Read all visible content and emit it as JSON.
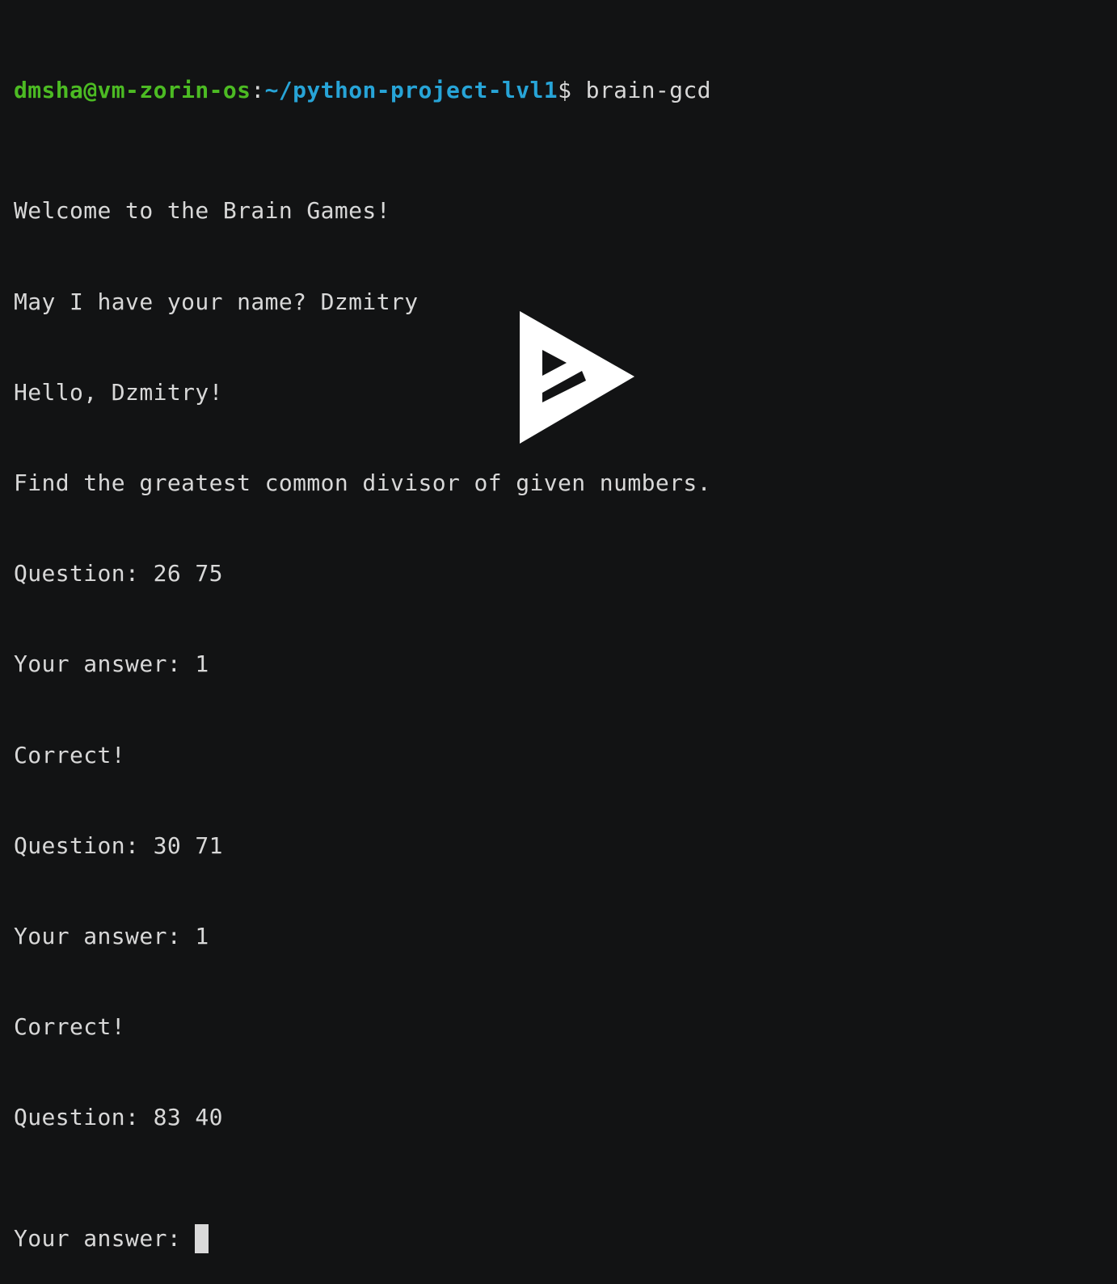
{
  "prompt": {
    "user_host": "dmsha@vm-zorin-os",
    "separator": ":",
    "path": "~/python-project-lvl1",
    "symbol": "$",
    "command": " brain-gcd"
  },
  "lines": [
    "Welcome to the Brain Games!",
    "May I have your name? Dzmitry",
    "Hello, Dzmitry!",
    "Find the greatest common divisor of given numbers.",
    "Question: 26 75",
    "Your answer: 1",
    "Correct!",
    "Question: 30 71",
    "Your answer: 1",
    "Correct!",
    "Question: 83 40"
  ],
  "current_input": {
    "label": "Your answer: "
  },
  "colors": {
    "background": "#121314",
    "text": "#d8d8d8",
    "user_host": "#4cbb23",
    "path": "#27a4d7",
    "overlay": "#ffffff"
  },
  "icons": {
    "overlay": "asciinema-play-icon"
  }
}
